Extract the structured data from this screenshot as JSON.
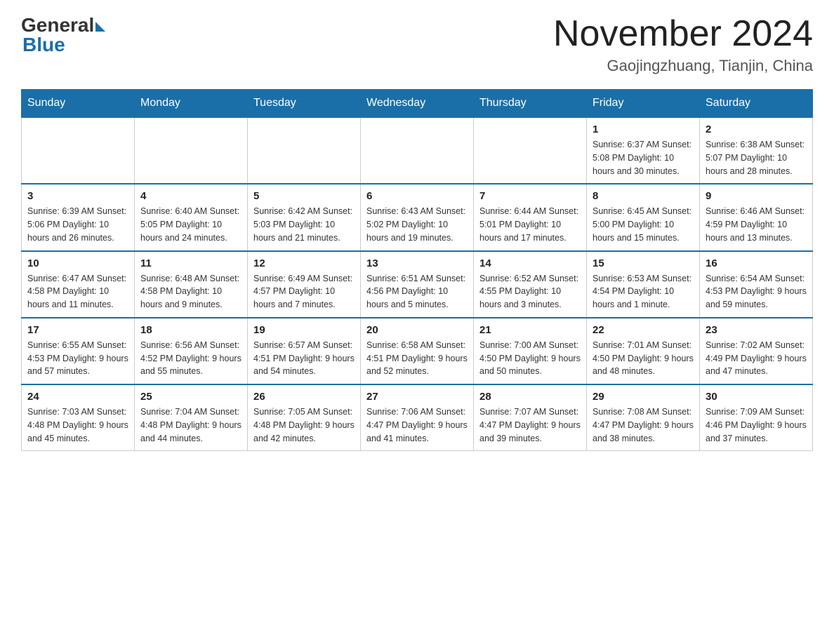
{
  "header": {
    "logo_general": "General",
    "logo_blue": "Blue",
    "title": "November 2024",
    "subtitle": "Gaojingzhuang, Tianjin, China"
  },
  "weekdays": [
    "Sunday",
    "Monday",
    "Tuesday",
    "Wednesday",
    "Thursday",
    "Friday",
    "Saturday"
  ],
  "weeks": [
    [
      {
        "day": "",
        "info": ""
      },
      {
        "day": "",
        "info": ""
      },
      {
        "day": "",
        "info": ""
      },
      {
        "day": "",
        "info": ""
      },
      {
        "day": "",
        "info": ""
      },
      {
        "day": "1",
        "info": "Sunrise: 6:37 AM\nSunset: 5:08 PM\nDaylight: 10 hours and 30 minutes."
      },
      {
        "day": "2",
        "info": "Sunrise: 6:38 AM\nSunset: 5:07 PM\nDaylight: 10 hours and 28 minutes."
      }
    ],
    [
      {
        "day": "3",
        "info": "Sunrise: 6:39 AM\nSunset: 5:06 PM\nDaylight: 10 hours and 26 minutes."
      },
      {
        "day": "4",
        "info": "Sunrise: 6:40 AM\nSunset: 5:05 PM\nDaylight: 10 hours and 24 minutes."
      },
      {
        "day": "5",
        "info": "Sunrise: 6:42 AM\nSunset: 5:03 PM\nDaylight: 10 hours and 21 minutes."
      },
      {
        "day": "6",
        "info": "Sunrise: 6:43 AM\nSunset: 5:02 PM\nDaylight: 10 hours and 19 minutes."
      },
      {
        "day": "7",
        "info": "Sunrise: 6:44 AM\nSunset: 5:01 PM\nDaylight: 10 hours and 17 minutes."
      },
      {
        "day": "8",
        "info": "Sunrise: 6:45 AM\nSunset: 5:00 PM\nDaylight: 10 hours and 15 minutes."
      },
      {
        "day": "9",
        "info": "Sunrise: 6:46 AM\nSunset: 4:59 PM\nDaylight: 10 hours and 13 minutes."
      }
    ],
    [
      {
        "day": "10",
        "info": "Sunrise: 6:47 AM\nSunset: 4:58 PM\nDaylight: 10 hours and 11 minutes."
      },
      {
        "day": "11",
        "info": "Sunrise: 6:48 AM\nSunset: 4:58 PM\nDaylight: 10 hours and 9 minutes."
      },
      {
        "day": "12",
        "info": "Sunrise: 6:49 AM\nSunset: 4:57 PM\nDaylight: 10 hours and 7 minutes."
      },
      {
        "day": "13",
        "info": "Sunrise: 6:51 AM\nSunset: 4:56 PM\nDaylight: 10 hours and 5 minutes."
      },
      {
        "day": "14",
        "info": "Sunrise: 6:52 AM\nSunset: 4:55 PM\nDaylight: 10 hours and 3 minutes."
      },
      {
        "day": "15",
        "info": "Sunrise: 6:53 AM\nSunset: 4:54 PM\nDaylight: 10 hours and 1 minute."
      },
      {
        "day": "16",
        "info": "Sunrise: 6:54 AM\nSunset: 4:53 PM\nDaylight: 9 hours and 59 minutes."
      }
    ],
    [
      {
        "day": "17",
        "info": "Sunrise: 6:55 AM\nSunset: 4:53 PM\nDaylight: 9 hours and 57 minutes."
      },
      {
        "day": "18",
        "info": "Sunrise: 6:56 AM\nSunset: 4:52 PM\nDaylight: 9 hours and 55 minutes."
      },
      {
        "day": "19",
        "info": "Sunrise: 6:57 AM\nSunset: 4:51 PM\nDaylight: 9 hours and 54 minutes."
      },
      {
        "day": "20",
        "info": "Sunrise: 6:58 AM\nSunset: 4:51 PM\nDaylight: 9 hours and 52 minutes."
      },
      {
        "day": "21",
        "info": "Sunrise: 7:00 AM\nSunset: 4:50 PM\nDaylight: 9 hours and 50 minutes."
      },
      {
        "day": "22",
        "info": "Sunrise: 7:01 AM\nSunset: 4:50 PM\nDaylight: 9 hours and 48 minutes."
      },
      {
        "day": "23",
        "info": "Sunrise: 7:02 AM\nSunset: 4:49 PM\nDaylight: 9 hours and 47 minutes."
      }
    ],
    [
      {
        "day": "24",
        "info": "Sunrise: 7:03 AM\nSunset: 4:48 PM\nDaylight: 9 hours and 45 minutes."
      },
      {
        "day": "25",
        "info": "Sunrise: 7:04 AM\nSunset: 4:48 PM\nDaylight: 9 hours and 44 minutes."
      },
      {
        "day": "26",
        "info": "Sunrise: 7:05 AM\nSunset: 4:48 PM\nDaylight: 9 hours and 42 minutes."
      },
      {
        "day": "27",
        "info": "Sunrise: 7:06 AM\nSunset: 4:47 PM\nDaylight: 9 hours and 41 minutes."
      },
      {
        "day": "28",
        "info": "Sunrise: 7:07 AM\nSunset: 4:47 PM\nDaylight: 9 hours and 39 minutes."
      },
      {
        "day": "29",
        "info": "Sunrise: 7:08 AM\nSunset: 4:47 PM\nDaylight: 9 hours and 38 minutes."
      },
      {
        "day": "30",
        "info": "Sunrise: 7:09 AM\nSunset: 4:46 PM\nDaylight: 9 hours and 37 minutes."
      }
    ]
  ]
}
